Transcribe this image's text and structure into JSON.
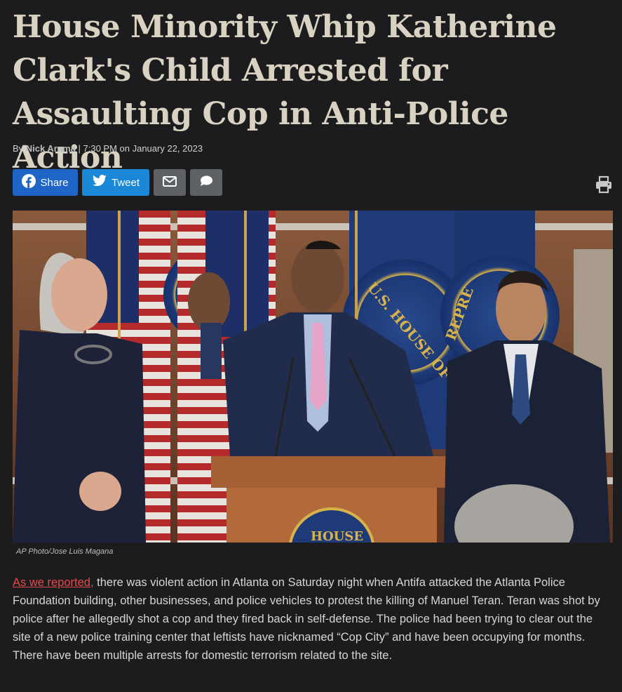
{
  "article": {
    "headline": "House Minority Whip Katherine Clark's Child Arrested for Assaulting Cop in Anti-Police Action",
    "byline_prefix": "By",
    "author": "Nick Arama",
    "byline_separator": "|",
    "timestamp": "7:30 PM on January 22, 2023"
  },
  "share": {
    "facebook_label": "Share",
    "twitter_label": "Tweet",
    "email_icon": "envelope-icon",
    "comment_icon": "comment-icon",
    "print_icon": "print-icon"
  },
  "image": {
    "caption": "AP Photo/Jose Luis Magana",
    "sign_text": "U.S. HOUSE OF",
    "sign_text_right": "REPRE",
    "podium_text": "HOUSE"
  },
  "body": {
    "link_text": "As we reported,",
    "paragraph": " there was violent action in Atlanta on Saturday night when Antifa attacked the Atlanta Police Foundation building, other businesses, and police vehicles to protest the killing of Manuel Teran. Teran was shot by police after he allegedly shot a cop and they fired back in self-defense. The police had been trying to clear out the site of a new police training center that leftists have nicknamed “Cop City” and have been occupying for months. There have been multiple arrests for domestic terrorism related to the site."
  },
  "colors": {
    "background": "#1c1c1e",
    "headline": "#d9d2c2",
    "facebook": "#1f65c8",
    "twitter": "#1a88d6",
    "link": "#e5484d"
  }
}
